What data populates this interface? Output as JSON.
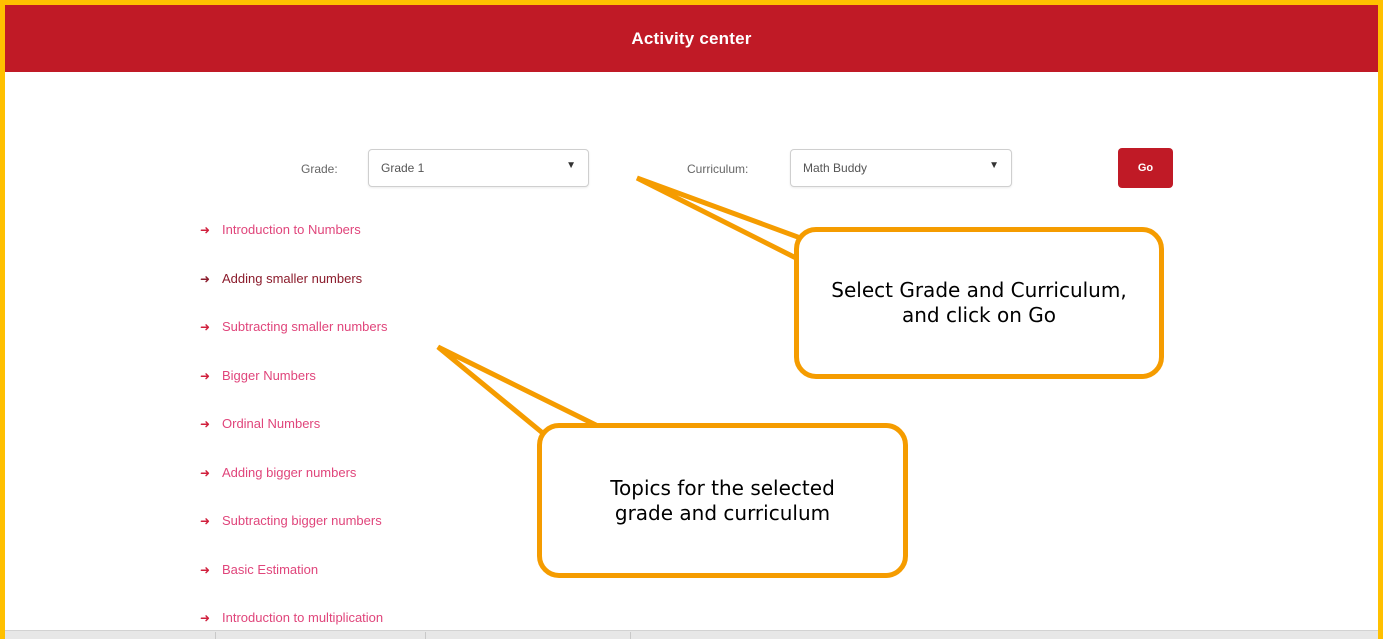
{
  "header": {
    "title": "Activity center"
  },
  "filters": {
    "grade_label": "Grade:",
    "grade_value": "Grade 1",
    "curriculum_label": "Curriculum:",
    "curriculum_value": "Math Buddy",
    "go_label": "Go"
  },
  "topics": [
    {
      "label": "Introduction to Numbers",
      "visited": false
    },
    {
      "label": "Adding smaller numbers",
      "visited": true
    },
    {
      "label": "Subtracting smaller numbers",
      "visited": false
    },
    {
      "label": "Bigger Numbers",
      "visited": false
    },
    {
      "label": "Ordinal Numbers",
      "visited": false
    },
    {
      "label": "Adding bigger numbers",
      "visited": false
    },
    {
      "label": "Subtracting bigger numbers",
      "visited": false
    },
    {
      "label": "Basic Estimation",
      "visited": false
    },
    {
      "label": "Introduction to multiplication",
      "visited": false
    }
  ],
  "callouts": {
    "select_hint": "Select Grade and Curriculum, and click on Go",
    "topics_hint": "Topics for the selected grade and curriculum"
  },
  "colors": {
    "header": "#c01a26",
    "frame": "#ffc000",
    "callout_border": "#f59c00",
    "topic_link": "#e0457b",
    "topic_visited": "#8b1c2c"
  },
  "icons": {
    "topic_bullet": "arrow-right-icon",
    "select_caret": "caret-down-icon"
  }
}
